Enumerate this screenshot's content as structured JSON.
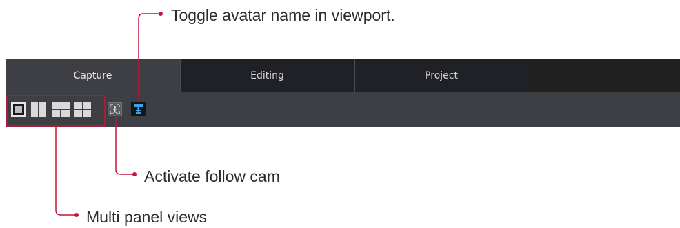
{
  "callouts": {
    "toggle_avatar_name": "Toggle avatar name in viewport.",
    "follow_cam": "Activate follow cam",
    "multi_panel": "Multi panel views"
  },
  "tabs": [
    {
      "label": "Capture",
      "active": true
    },
    {
      "label": "Editing",
      "active": false
    },
    {
      "label": "Project",
      "active": false
    }
  ],
  "toolbar": {
    "buttons": [
      {
        "icon": "single-panel-icon"
      },
      {
        "icon": "two-panel-icon"
      },
      {
        "icon": "three-panel-icon"
      },
      {
        "icon": "four-panel-icon"
      },
      {
        "icon": "follow-cam-icon"
      },
      {
        "icon": "avatar-name-icon"
      }
    ]
  },
  "colors": {
    "annotation": "#c0163a",
    "tab_active_bg": "#3e3f44",
    "tab_inactive_bg": "#202126",
    "toolbar_bg": "#3e3f44",
    "avatar_icon_accent": "#3aa3e3"
  }
}
